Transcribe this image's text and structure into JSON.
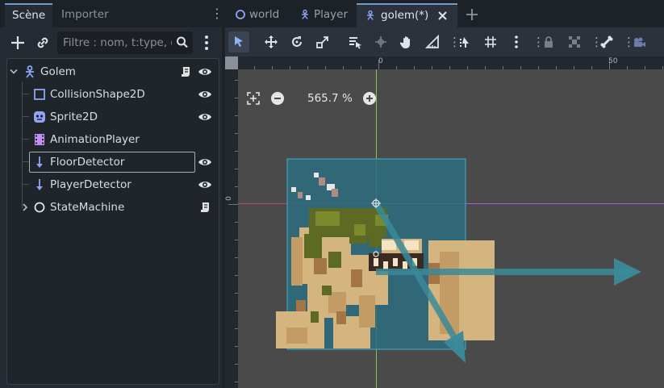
{
  "dock": {
    "tabs": [
      {
        "label": "Scène",
        "active": true
      },
      {
        "label": "Importer",
        "active": false
      }
    ],
    "filter_placeholder": "Filtre : nom, t:type, g",
    "tree": [
      {
        "label": "Golem",
        "icon": "characterbody2d-icon",
        "depth": 0,
        "expanded": true,
        "script": true,
        "visible_toggle": true
      },
      {
        "label": "CollisionShape2D",
        "icon": "collisionshape2d-icon",
        "depth": 1,
        "visible_toggle": true
      },
      {
        "label": "Sprite2D",
        "icon": "sprite2d-icon",
        "depth": 1,
        "visible_toggle": true
      },
      {
        "label": "AnimationPlayer",
        "icon": "animationplayer-icon",
        "depth": 1,
        "visible_toggle": false
      },
      {
        "label": "FloorDetector",
        "icon": "raycast2d-icon",
        "depth": 1,
        "visible_toggle": true,
        "selected": true
      },
      {
        "label": "PlayerDetector",
        "icon": "raycast2d-icon",
        "depth": 1,
        "visible_toggle": true
      },
      {
        "label": "StateMachine",
        "icon": "node-icon",
        "depth": 1,
        "expandable": true,
        "script": true,
        "visible_toggle": false
      }
    ]
  },
  "scene_tabs": [
    {
      "label": "world",
      "icon": "node-icon",
      "active": false
    },
    {
      "label": "Player",
      "icon": "characterbody2d-icon",
      "active": false
    },
    {
      "label": "golem(*)",
      "icon": "characterbody2d-icon",
      "active": true,
      "closable": true
    }
  ],
  "viewport": {
    "zoom_label": "565.7 %",
    "ruler_top_labels": [
      "0",
      "50"
    ],
    "ruler_left_labels": [
      "0"
    ]
  },
  "colors": {
    "accent": "#6f9bd1",
    "selection_rect": "#2f7a8f",
    "raycast_arrow": "#3a8a99",
    "x_axis": "#c0455a",
    "y_axis": "#8bc34a"
  }
}
